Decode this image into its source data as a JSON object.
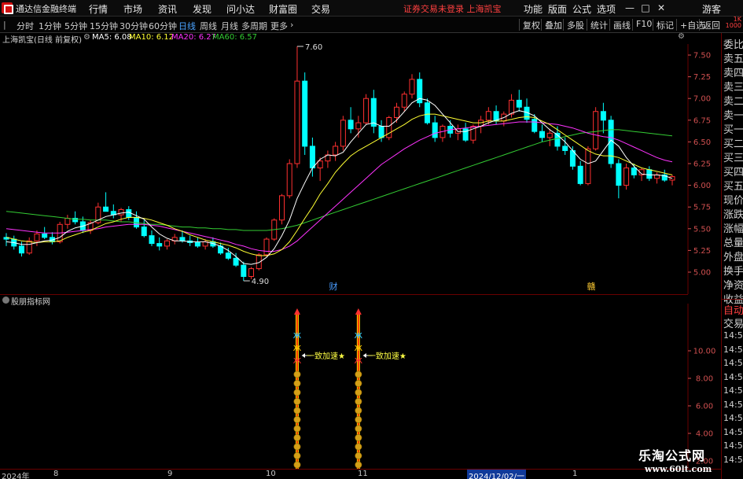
{
  "menubar": {
    "app_title": "通达信金融终端",
    "items": [
      "行情",
      "市场",
      "资讯",
      "发现",
      "问小达",
      "财富圈",
      "交易"
    ],
    "notice": "证券交易未登录 上海凯宝",
    "right_items": [
      "功能",
      "版面",
      "公式",
      "选项"
    ],
    "user": "游客"
  },
  "toolbar": {
    "periods": [
      "分时",
      "1分钟",
      "5分钟",
      "15分钟",
      "30分钟",
      "60分钟",
      "日线",
      "周线",
      "月线",
      "多周期",
      "更多"
    ],
    "active_period": "日线",
    "right_buttons": [
      "复权",
      "叠加",
      "多股",
      "统计",
      "画线",
      "F10",
      "标记",
      "+自选",
      "返回"
    ],
    "vol_mini": [
      "1K",
      "1000"
    ]
  },
  "info": {
    "stock": "上海凯宝(日线 前复权)",
    "ma5": "MA5: 6.08",
    "ma10": "MA10: 6.12",
    "ma20": "MA20: 6.27",
    "ma60": "MA60: 6.57"
  },
  "colors": {
    "up": "#ff3030",
    "down": "#00ffff",
    "ma5": "#ffffff",
    "ma10": "#ffff33",
    "ma20": "#ff33ff",
    "ma60": "#33cc33",
    "grid": "#6a0000",
    "axis_text": "#d05050"
  },
  "main_chart": {
    "price_axis": [
      "7.50",
      "7.25",
      "7.00",
      "6.75",
      "6.50",
      "6.25",
      "6.00",
      "5.75",
      "5.50",
      "5.25",
      "5.00"
    ],
    "high_label": "7.60",
    "low_label": "4.90",
    "event_markers": [
      "财",
      "赣"
    ]
  },
  "indicator": {
    "name": "股朋指标网",
    "axis": [
      "10.00",
      "8.00",
      "6.00",
      "4.00",
      "2.00"
    ],
    "signal_label": "一致加速★"
  },
  "right_panel": {
    "items": [
      "委比",
      "卖五",
      "卖四",
      "卖三",
      "卖二",
      "卖一",
      "买一",
      "买二",
      "买三",
      "买四",
      "买五",
      "现价",
      "涨跌",
      "涨幅",
      "总量",
      "外盘",
      "换手",
      "净资",
      "收益"
    ],
    "mode": [
      "自动",
      "交易"
    ],
    "times": [
      "14:56",
      "14:56",
      "14:56",
      "14:56",
      "14:56",
      "14:56",
      "14:56",
      "14:56",
      "14:56",
      "14:56"
    ]
  },
  "date_axis": {
    "labels": [
      "2024年",
      "8",
      "9",
      "10",
      "11",
      "2024/12/02/一",
      "1"
    ]
  },
  "watermark": {
    "line1": "乐淘公式网",
    "line2": "www.60lt.com"
  },
  "chart_data": {
    "type": "candlestick",
    "ylim": [
      4.75,
      7.75
    ],
    "series": [
      {
        "name": "MA5"
      },
      {
        "name": "MA10"
      },
      {
        "name": "MA20"
      },
      {
        "name": "MA60"
      }
    ],
    "ohlc": [
      [
        5.4,
        5.45,
        5.3,
        5.38
      ],
      [
        5.38,
        5.42,
        5.26,
        5.3
      ],
      [
        5.3,
        5.35,
        5.18,
        5.22
      ],
      [
        5.22,
        5.4,
        5.2,
        5.36
      ],
      [
        5.36,
        5.48,
        5.3,
        5.44
      ],
      [
        5.44,
        5.52,
        5.38,
        5.4
      ],
      [
        5.4,
        5.46,
        5.32,
        5.35
      ],
      [
        5.35,
        5.58,
        5.33,
        5.55
      ],
      [
        5.55,
        5.66,
        5.5,
        5.62
      ],
      [
        5.62,
        5.7,
        5.55,
        5.58
      ],
      [
        5.58,
        5.64,
        5.45,
        5.48
      ],
      [
        5.48,
        5.6,
        5.44,
        5.57
      ],
      [
        5.57,
        5.8,
        5.55,
        5.75
      ],
      [
        5.75,
        5.92,
        5.7,
        5.7
      ],
      [
        5.7,
        5.78,
        5.62,
        5.66
      ],
      [
        5.66,
        5.74,
        5.58,
        5.72
      ],
      [
        5.72,
        5.76,
        5.6,
        5.63
      ],
      [
        5.63,
        5.7,
        5.5,
        5.52
      ],
      [
        5.52,
        5.6,
        5.4,
        5.42
      ],
      [
        5.42,
        5.48,
        5.3,
        5.33
      ],
      [
        5.33,
        5.4,
        5.25,
        5.3
      ],
      [
        5.3,
        5.38,
        5.26,
        5.36
      ],
      [
        5.36,
        5.44,
        5.32,
        5.4
      ],
      [
        5.4,
        5.48,
        5.34,
        5.36
      ],
      [
        5.36,
        5.42,
        5.3,
        5.34
      ],
      [
        5.34,
        5.4,
        5.28,
        5.3
      ],
      [
        5.3,
        5.38,
        5.26,
        5.35
      ],
      [
        5.35,
        5.4,
        5.28,
        5.3
      ],
      [
        5.3,
        5.34,
        5.2,
        5.22
      ],
      [
        5.22,
        5.28,
        5.14,
        5.16
      ],
      [
        5.16,
        5.22,
        5.06,
        5.08
      ],
      [
        5.08,
        5.12,
        4.9,
        4.95
      ],
      [
        4.95,
        5.06,
        4.92,
        5.04
      ],
      [
        5.04,
        5.22,
        5.02,
        5.2
      ],
      [
        5.2,
        5.4,
        5.18,
        5.38
      ],
      [
        5.38,
        5.62,
        5.36,
        5.6
      ],
      [
        5.6,
        5.9,
        5.55,
        5.88
      ],
      [
        5.88,
        6.3,
        5.85,
        6.25
      ],
      [
        6.25,
        7.6,
        6.2,
        7.2
      ],
      [
        7.2,
        7.3,
        6.35,
        6.45
      ],
      [
        6.45,
        6.55,
        6.1,
        6.2
      ],
      [
        6.2,
        6.32,
        6.05,
        6.28
      ],
      [
        6.28,
        6.4,
        6.2,
        6.35
      ],
      [
        6.35,
        6.5,
        6.28,
        6.45
      ],
      [
        6.45,
        6.8,
        6.4,
        6.75
      ],
      [
        6.75,
        6.9,
        6.6,
        6.65
      ],
      [
        6.65,
        6.8,
        6.55,
        6.72
      ],
      [
        6.72,
        7.05,
        6.7,
        7.0
      ],
      [
        7.0,
        7.1,
        6.6,
        6.68
      ],
      [
        6.68,
        6.75,
        6.5,
        6.55
      ],
      [
        6.55,
        6.8,
        6.52,
        6.78
      ],
      [
        6.78,
        6.95,
        6.72,
        6.9
      ],
      [
        6.9,
        7.08,
        6.85,
        7.05
      ],
      [
        7.05,
        7.28,
        7.0,
        7.22
      ],
      [
        7.22,
        7.3,
        6.9,
        6.95
      ],
      [
        6.95,
        7.0,
        6.7,
        6.72
      ],
      [
        6.72,
        6.8,
        6.5,
        6.55
      ],
      [
        6.55,
        6.7,
        6.5,
        6.68
      ],
      [
        6.68,
        6.75,
        6.55,
        6.6
      ],
      [
        6.6,
        6.7,
        6.52,
        6.65
      ],
      [
        6.65,
        6.72,
        6.5,
        6.52
      ],
      [
        6.52,
        6.7,
        6.48,
        6.68
      ],
      [
        6.68,
        6.8,
        6.6,
        6.75
      ],
      [
        6.75,
        6.9,
        6.7,
        6.85
      ],
      [
        6.85,
        6.92,
        6.7,
        6.74
      ],
      [
        6.74,
        6.85,
        6.68,
        6.82
      ],
      [
        6.82,
        7.05,
        6.78,
        6.98
      ],
      [
        6.98,
        7.1,
        6.85,
        6.9
      ],
      [
        6.9,
        7.0,
        6.72,
        6.76
      ],
      [
        6.76,
        6.82,
        6.6,
        6.62
      ],
      [
        6.62,
        6.7,
        6.5,
        6.55
      ],
      [
        6.55,
        6.65,
        6.45,
        6.6
      ],
      [
        6.6,
        6.68,
        6.4,
        6.45
      ],
      [
        6.45,
        6.55,
        6.35,
        6.4
      ],
      [
        6.4,
        6.45,
        6.18,
        6.22
      ],
      [
        6.22,
        6.28,
        6.0,
        6.02
      ],
      [
        6.02,
        6.45,
        6.0,
        6.42
      ],
      [
        6.42,
        6.9,
        6.4,
        6.85
      ],
      [
        6.85,
        6.95,
        6.6,
        6.75
      ],
      [
        6.75,
        6.8,
        6.2,
        6.25
      ],
      [
        6.25,
        6.3,
        5.85,
        6.0
      ],
      [
        6.0,
        6.25,
        5.95,
        6.2
      ],
      [
        6.2,
        6.25,
        6.08,
        6.12
      ],
      [
        6.12,
        6.2,
        6.05,
        6.18
      ],
      [
        6.18,
        6.22,
        6.05,
        6.08
      ],
      [
        6.08,
        6.15,
        6.02,
        6.12
      ],
      [
        6.12,
        6.18,
        6.04,
        6.06
      ],
      [
        6.06,
        6.12,
        6.0,
        6.1
      ]
    ],
    "ma5": [
      5.35,
      5.34,
      5.32,
      5.32,
      5.34,
      5.36,
      5.37,
      5.4,
      5.47,
      5.51,
      5.53,
      5.56,
      5.6,
      5.64,
      5.66,
      5.68,
      5.69,
      5.65,
      5.61,
      5.52,
      5.44,
      5.39,
      5.36,
      5.36,
      5.35,
      5.35,
      5.35,
      5.33,
      5.3,
      5.25,
      5.18,
      5.1,
      5.09,
      5.11,
      5.17,
      5.27,
      5.42,
      5.6,
      5.85,
      6.03,
      6.2,
      6.3,
      6.35,
      6.34,
      6.38,
      6.5,
      6.6,
      6.7,
      6.72,
      6.68,
      6.68,
      6.75,
      6.85,
      6.95,
      7.0,
      6.98,
      6.92,
      6.82,
      6.72,
      6.62,
      6.62,
      6.65,
      6.68,
      6.72,
      6.75,
      6.78,
      6.83,
      6.86,
      6.84,
      6.8,
      6.72,
      6.64,
      6.58,
      6.5,
      6.4,
      6.3,
      6.25,
      6.28,
      6.4,
      6.52,
      6.45,
      6.32,
      6.22,
      6.13,
      6.12,
      6.12,
      6.11,
      6.08
    ],
    "ma10": [
      5.4,
      5.38,
      5.36,
      5.35,
      5.34,
      5.35,
      5.35,
      5.36,
      5.4,
      5.43,
      5.46,
      5.48,
      5.52,
      5.56,
      5.58,
      5.61,
      5.63,
      5.63,
      5.62,
      5.6,
      5.57,
      5.54,
      5.5,
      5.47,
      5.43,
      5.4,
      5.37,
      5.35,
      5.33,
      5.31,
      5.28,
      5.24,
      5.21,
      5.19,
      5.19,
      5.21,
      5.26,
      5.35,
      5.48,
      5.62,
      5.75,
      5.9,
      6.02,
      6.15,
      6.25,
      6.34,
      6.4,
      6.45,
      6.5,
      6.55,
      6.6,
      6.65,
      6.7,
      6.76,
      6.8,
      6.82,
      6.82,
      6.8,
      6.78,
      6.76,
      6.74,
      6.72,
      6.72,
      6.74,
      6.74,
      6.74,
      6.76,
      6.78,
      6.79,
      6.78,
      6.74,
      6.7,
      6.64,
      6.58,
      6.52,
      6.46,
      6.4,
      6.36,
      6.34,
      6.34,
      6.32,
      6.28,
      6.24,
      6.2,
      6.18,
      6.16,
      6.14,
      6.12
    ],
    "ma20": [
      5.5,
      5.49,
      5.48,
      5.47,
      5.46,
      5.45,
      5.45,
      5.45,
      5.46,
      5.47,
      5.48,
      5.49,
      5.5,
      5.52,
      5.53,
      5.54,
      5.55,
      5.55,
      5.55,
      5.54,
      5.53,
      5.51,
      5.49,
      5.47,
      5.45,
      5.43,
      5.41,
      5.39,
      5.37,
      5.35,
      5.32,
      5.3,
      5.27,
      5.25,
      5.24,
      5.24,
      5.26,
      5.3,
      5.36,
      5.44,
      5.52,
      5.6,
      5.68,
      5.76,
      5.84,
      5.92,
      6.0,
      6.08,
      6.16,
      6.24,
      6.3,
      6.36,
      6.42,
      6.47,
      6.52,
      6.56,
      6.6,
      6.62,
      6.64,
      6.65,
      6.66,
      6.67,
      6.68,
      6.69,
      6.7,
      6.71,
      6.72,
      6.73,
      6.73,
      6.73,
      6.72,
      6.71,
      6.7,
      6.68,
      6.66,
      6.63,
      6.6,
      6.58,
      6.56,
      6.55,
      6.52,
      6.48,
      6.44,
      6.4,
      6.36,
      6.32,
      6.29,
      6.27
    ],
    "ma60": [
      5.7,
      5.69,
      5.68,
      5.67,
      5.66,
      5.65,
      5.64,
      5.63,
      5.62,
      5.61,
      5.61,
      5.6,
      5.6,
      5.6,
      5.59,
      5.58,
      5.58,
      5.57,
      5.56,
      5.55,
      5.55,
      5.54,
      5.53,
      5.52,
      5.52,
      5.51,
      5.51,
      5.5,
      5.5,
      5.49,
      5.49,
      5.48,
      5.48,
      5.48,
      5.48,
      5.49,
      5.5,
      5.52,
      5.54,
      5.57,
      5.6,
      5.63,
      5.66,
      5.69,
      5.72,
      5.75,
      5.78,
      5.81,
      5.84,
      5.87,
      5.9,
      5.93,
      5.96,
      5.99,
      6.02,
      6.05,
      6.08,
      6.11,
      6.14,
      6.17,
      6.2,
      6.23,
      6.26,
      6.29,
      6.32,
      6.35,
      6.38,
      6.41,
      6.44,
      6.47,
      6.5,
      6.52,
      6.54,
      6.56,
      6.58,
      6.6,
      6.61,
      6.62,
      6.63,
      6.64,
      6.64,
      6.63,
      6.62,
      6.61,
      6.6,
      6.59,
      6.58,
      6.57
    ],
    "signal_days": [
      38,
      46
    ]
  }
}
